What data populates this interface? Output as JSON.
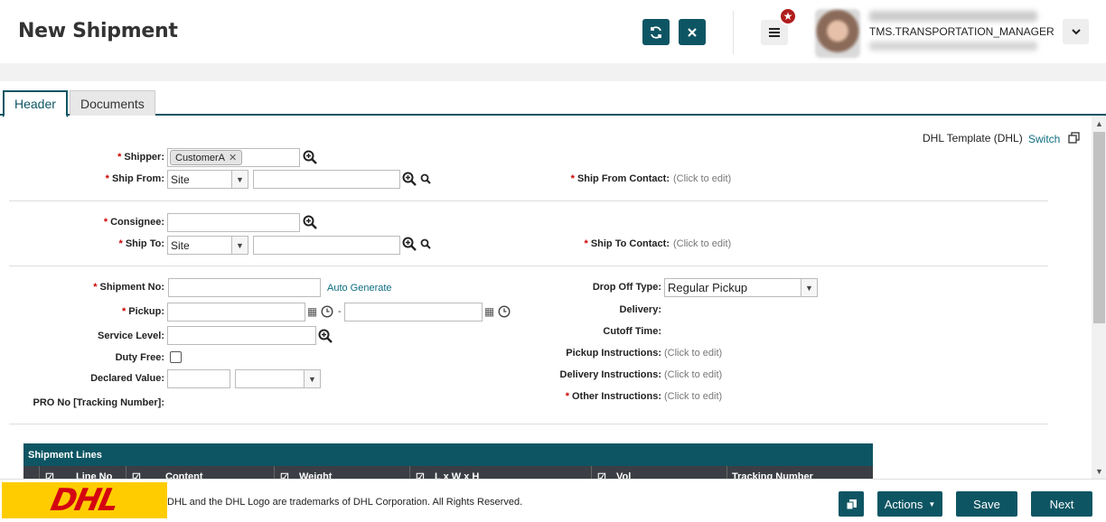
{
  "header": {
    "title": "New Shipment",
    "notification_count_icon": "star-icon",
    "user_role": "TMS.TRANSPORTATION_MANAGER"
  },
  "tabs": [
    {
      "label": "Header",
      "active": true
    },
    {
      "label": "Documents",
      "active": false
    }
  ],
  "template": {
    "label": "DHL Template (DHL)",
    "switch_label": "Switch"
  },
  "form": {
    "shipper_label": "Shipper:",
    "shipper_tag": "CustomerA",
    "ship_from_label": "Ship From:",
    "ship_from_type": "Site",
    "ship_from_contact_label": "Ship From Contact:",
    "ship_from_contact_value": "(Click to edit)",
    "consignee_label": "Consignee:",
    "ship_to_label": "Ship To:",
    "ship_to_type": "Site",
    "ship_to_contact_label": "Ship To Contact:",
    "ship_to_contact_value": "(Click to edit)",
    "shipment_no_label": "Shipment No:",
    "auto_generate": "Auto Generate",
    "pickup_label": "Pickup:",
    "pickup_sep": "-",
    "service_level_label": "Service Level:",
    "duty_free_label": "Duty Free:",
    "declared_value_label": "Declared Value:",
    "pro_no_label": "PRO No [Tracking Number]:",
    "drop_off_type_label": "Drop Off Type:",
    "drop_off_type_value": "Regular Pickup",
    "delivery_label": "Delivery:",
    "cutoff_time_label": "Cutoff Time:",
    "pickup_instructions_label": "Pickup Instructions:",
    "pickup_instructions_value": "(Click to edit)",
    "delivery_instructions_label": "Delivery Instructions:",
    "delivery_instructions_value": "(Click to edit)",
    "other_instructions_label": "Other Instructions:",
    "other_instructions_value": "(Click to edit)"
  },
  "shipment_lines": {
    "title": "Shipment Lines",
    "columns": [
      "Line No",
      "Content",
      "Weight",
      "L x W x H",
      "Vol",
      "Tracking Number"
    ]
  },
  "footer": {
    "logo_text": "DHL",
    "trademark": "DHL and the DHL Logo are trademarks of DHL Corporation. All Rights Reserved.",
    "actions_label": "Actions",
    "save_label": "Save",
    "next_label": "Next"
  },
  "colors": {
    "primary": "#0e5563",
    "required": "#cc0000",
    "dhl_yellow": "#ffcc00",
    "dhl_red": "#d40511"
  }
}
